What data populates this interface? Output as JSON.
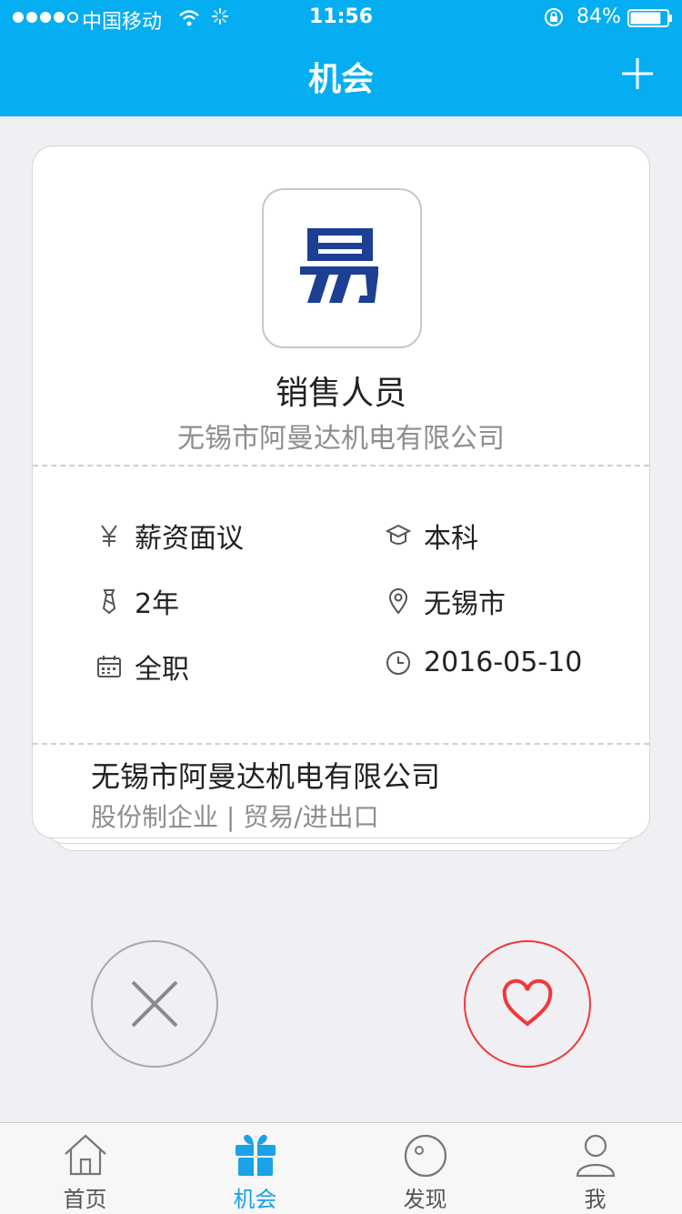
{
  "status_bar": {
    "carrier": "中国移动",
    "time": "11:56",
    "battery": "84%",
    "battery_level": 0.84
  },
  "nav": {
    "title": "机会"
  },
  "job": {
    "logo_text": "易",
    "title": "销售人员",
    "company": "无锡市阿曼达机电有限公司",
    "salary": "薪资面议",
    "education": "本科",
    "experience": "2年",
    "location": "无锡市",
    "job_type": "全职",
    "date": "2016-05-10"
  },
  "company": {
    "name": "无锡市阿曼达机电有限公司",
    "meta": "股份制企业 | 贸易/进出口"
  },
  "tabs": [
    {
      "label": "首页",
      "icon": "home-icon"
    },
    {
      "label": "机会",
      "icon": "gift-icon",
      "active": true
    },
    {
      "label": "发现",
      "icon": "discover-icon"
    },
    {
      "label": "我",
      "icon": "profile-icon"
    }
  ],
  "colors": {
    "brand": "#05aef0",
    "like": "#f0383a",
    "logo": "#1c3f94"
  }
}
